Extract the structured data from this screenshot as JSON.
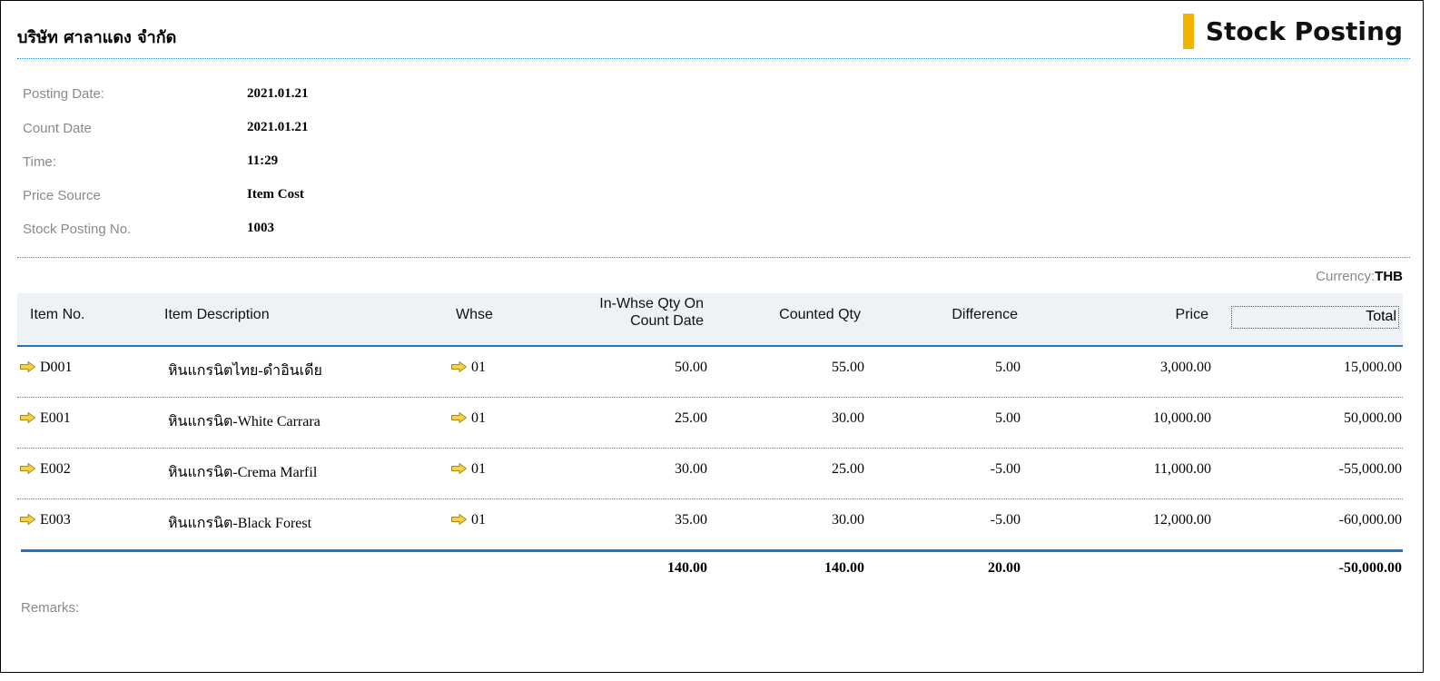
{
  "company": "บริษัท ศาลาแดง จำกัด",
  "title": "Stock Posting",
  "info": [
    {
      "label": "Posting Date:",
      "value": "2021.01.21"
    },
    {
      "label": "Count Date",
      "value": "2021.01.21"
    },
    {
      "label": "Time:",
      "value": "11:29"
    },
    {
      "label": "Price Source",
      "value": "Item Cost"
    },
    {
      "label": "Stock Posting No.",
      "value": "1003"
    }
  ],
  "currency": {
    "label": "Currency:",
    "value": "THB"
  },
  "columns": {
    "item_no": "Item No.",
    "description": "Item Description",
    "whse": "Whse",
    "in_whse_line1": "In-Whse Qty On",
    "in_whse_line2": "Count Date",
    "counted": "Counted Qty",
    "difference": "Difference",
    "price": "Price",
    "total": "Total"
  },
  "rows": [
    {
      "item_no": "D001",
      "description": "หินแกรนิตไทย-ดำอินเดีย",
      "whse": "01",
      "in_whse": "50.00",
      "counted": "55.00",
      "difference": "5.00",
      "price": "3,000.00",
      "total": "15,000.00"
    },
    {
      "item_no": "E001",
      "description": "หินแกรนิต-White Carrara",
      "whse": "01",
      "in_whse": "25.00",
      "counted": "30.00",
      "difference": "5.00",
      "price": "10,000.00",
      "total": "50,000.00"
    },
    {
      "item_no": "E002",
      "description": "หินแกรนิต-Crema Marfil",
      "whse": "01",
      "in_whse": "30.00",
      "counted": "25.00",
      "difference": "-5.00",
      "price": "11,000.00",
      "total": "-55,000.00"
    },
    {
      "item_no": "E003",
      "description": "หินแกรนิต-Black Forest",
      "whse": "01",
      "in_whse": "35.00",
      "counted": "30.00",
      "difference": "-5.00",
      "price": "12,000.00",
      "total": "-60,000.00"
    }
  ],
  "totals": {
    "in_whse": "140.00",
    "counted": "140.00",
    "difference": "20.00",
    "total": "-50,000.00"
  },
  "remarks_label": "Remarks:",
  "icons": {
    "link_arrow": "link-arrow-icon"
  },
  "colors": {
    "accent": "#f2b200",
    "rule": "#1e74c8",
    "label": "#8a8a8a",
    "header_bg": "#eef1f5"
  }
}
